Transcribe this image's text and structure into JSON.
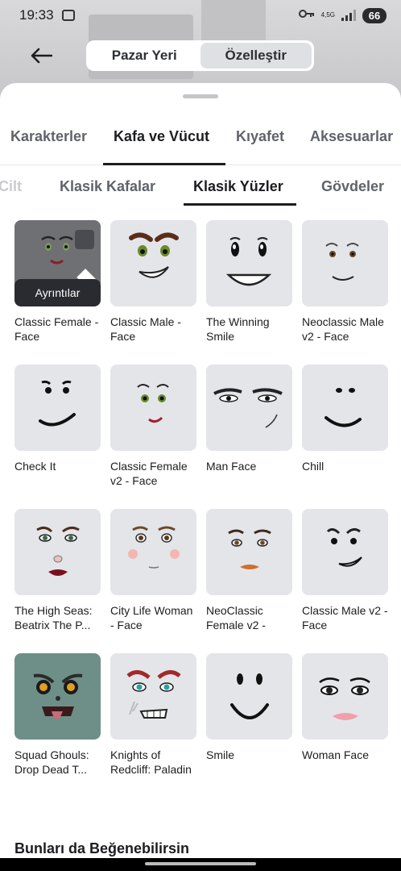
{
  "status": {
    "time": "19:33",
    "network": "4,5G",
    "battery": "66"
  },
  "header": {
    "segments": [
      {
        "label": "Pazar Yeri",
        "active": false
      },
      {
        "label": "Özelleştir",
        "active": true
      }
    ]
  },
  "category_tabs": [
    {
      "label": "Karakterler",
      "active": false
    },
    {
      "label": "Kafa ve Vücut",
      "active": true
    },
    {
      "label": "Kıyafet",
      "active": false
    },
    {
      "label": "Aksesuarlar",
      "active": false
    }
  ],
  "sub_tabs": [
    {
      "label": "Cilt",
      "active": false
    },
    {
      "label": "Klasik Kafalar",
      "active": false
    },
    {
      "label": "Klasik Yüzler",
      "active": true
    },
    {
      "label": "Gövdeler",
      "active": false
    }
  ],
  "items": [
    {
      "name": "Classic Female - Face",
      "selected": true,
      "overlay": "Ayrıntılar"
    },
    {
      "name": "Classic Male - Face"
    },
    {
      "name": "The Winning Smile"
    },
    {
      "name": "Neoclassic Male v2 - Face"
    },
    {
      "name": "Check It"
    },
    {
      "name": "Classic Female v2 - Face"
    },
    {
      "name": "Man Face"
    },
    {
      "name": "Chill"
    },
    {
      "name": "The High Seas: Beatrix The P..."
    },
    {
      "name": "City Life Woman - Face"
    },
    {
      "name": "NeoClassic Female v2 -"
    },
    {
      "name": "Classic Male v2 - Face"
    },
    {
      "name": "Squad Ghouls: Drop Dead T..."
    },
    {
      "name": "Knights of Redcliff: Paladin"
    },
    {
      "name": "Smile"
    },
    {
      "name": "Woman Face"
    }
  ],
  "recommend_title": "Bunları da Beğenebilirsin"
}
